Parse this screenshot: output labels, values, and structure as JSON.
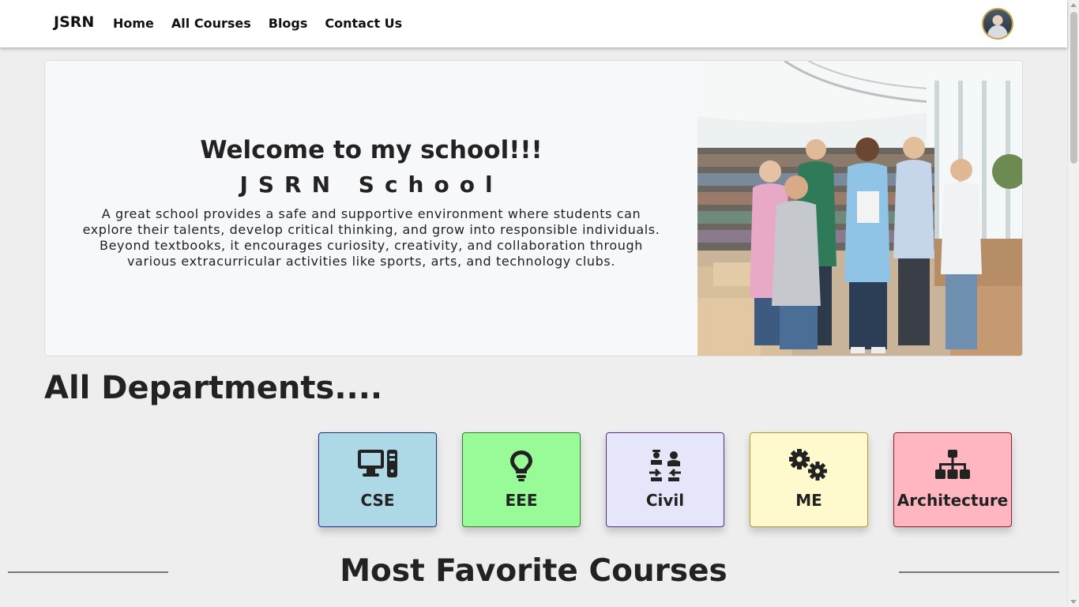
{
  "nav": {
    "brand": "JSRN",
    "links": [
      "Home",
      "All Courses",
      "Blogs",
      "Contact Us"
    ]
  },
  "hero": {
    "title": "Welcome to my school!!!",
    "subtitle": "JSRN School",
    "description": "A great school provides a safe and supportive environment where students can explore their talents, develop critical thinking, and grow into responsible individuals. Beyond textbooks, it encourages curiosity, creativity, and collaboration through various extracurricular activities like sports, arts, and technology clubs."
  },
  "departments": {
    "heading": "All Departments....",
    "items": [
      {
        "label": "CSE",
        "icon": "computer-icon",
        "bg": "#add8e6",
        "border": "#1f2a8c"
      },
      {
        "label": "EEE",
        "icon": "lightbulb-icon",
        "bg": "#98fb98",
        "border": "#2f7d2f"
      },
      {
        "label": "Civil",
        "icon": "workers-icon",
        "bg": "#e6e6fa",
        "border": "#5a2d8c"
      },
      {
        "label": "ME",
        "icon": "gears-icon",
        "bg": "#fffacd",
        "border": "#b89a2a"
      },
      {
        "label": "Architecture",
        "icon": "sitemap-icon",
        "bg": "#ffb6c1",
        "border": "#8c1f2a"
      }
    ]
  },
  "favorites": {
    "heading": "Most Favorite Courses"
  }
}
